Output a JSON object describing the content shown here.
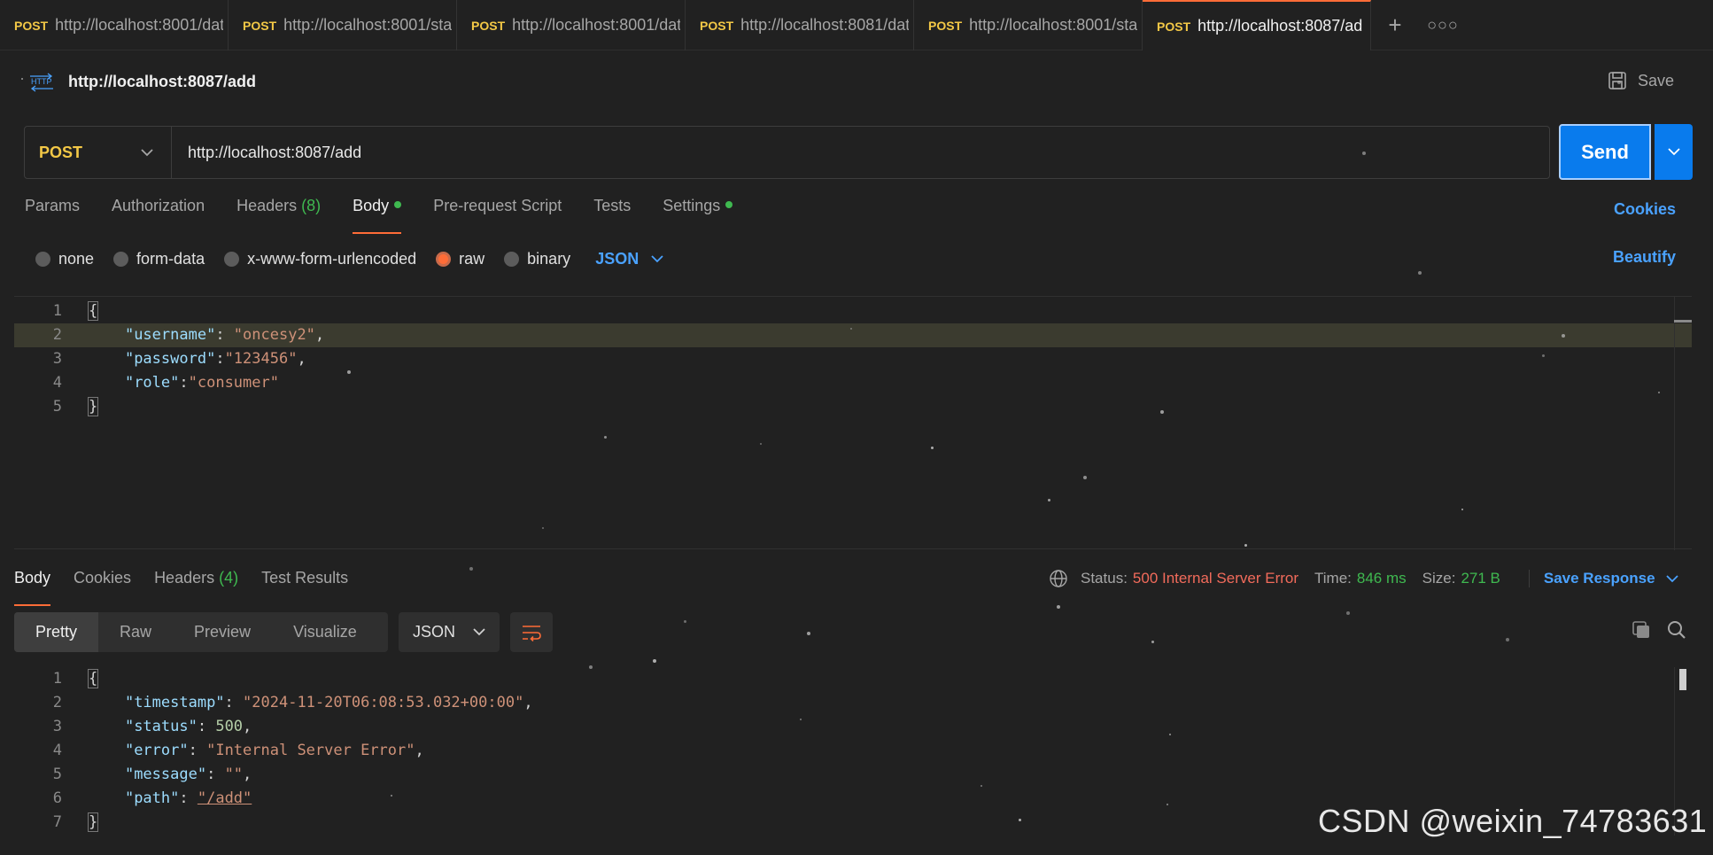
{
  "tabs": [
    {
      "method": "POST",
      "url": "http://localhost:8001/dat"
    },
    {
      "method": "POST",
      "url": "http://localhost:8001/sta"
    },
    {
      "method": "POST",
      "url": "http://localhost:8001/dat"
    },
    {
      "method": "POST",
      "url": "http://localhost:8081/dat"
    },
    {
      "method": "POST",
      "url": "http://localhost:8001/sta"
    },
    {
      "method": "POST",
      "url": "http://localhost:8087/ad"
    }
  ],
  "request": {
    "title": "http://localhost:8087/add",
    "save_label": "Save",
    "method": "POST",
    "url": "http://localhost:8087/add",
    "send_label": "Send"
  },
  "request_tabs": {
    "params": "Params",
    "authorization": "Authorization",
    "headers": "Headers",
    "headers_count": "(8)",
    "body": "Body",
    "prerequest": "Pre-request Script",
    "tests": "Tests",
    "settings": "Settings",
    "cookies": "Cookies"
  },
  "body_types": {
    "none": "none",
    "form_data": "form-data",
    "urlencoded": "x-www-form-urlencoded",
    "raw": "raw",
    "binary": "binary",
    "format": "JSON",
    "beautify": "Beautify"
  },
  "request_body": {
    "line_numbers": [
      "1",
      "2",
      "3",
      "4",
      "5"
    ],
    "username_key": "\"username\"",
    "username_value": "\"oncesy2\"",
    "password_key": "\"password\"",
    "password_value": "\"123456\"",
    "role_key": "\"role\"",
    "role_value": "\"consumer\""
  },
  "response_tabs": {
    "body": "Body",
    "cookies": "Cookies",
    "headers": "Headers",
    "headers_count": "(4)",
    "test_results": "Test Results"
  },
  "status": {
    "status_label": "Status:",
    "status_value": "500 Internal Server Error",
    "time_label": "Time:",
    "time_value": "846 ms",
    "size_label": "Size:",
    "size_value": "271 B",
    "save_response": "Save Response"
  },
  "views": {
    "pretty": "Pretty",
    "raw": "Raw",
    "preview": "Preview",
    "visualize": "Visualize",
    "format": "JSON"
  },
  "response_body": {
    "line_numbers": [
      "1",
      "2",
      "3",
      "4",
      "5",
      "6",
      "7"
    ],
    "timestamp_key": "\"timestamp\"",
    "timestamp_value": "\"2024-11-20T06:08:53.032+00:00\"",
    "status_key": "\"status\"",
    "status_value": "500",
    "error_key": "\"error\"",
    "error_value": "\"Internal Server Error\"",
    "message_key": "\"message\"",
    "message_value": "\"\"",
    "path_key": "\"path\"",
    "path_value": "\"/add\""
  },
  "watermark": "CSDN @weixin_74783631",
  "colors": {
    "accent": "#ff6c37",
    "send": "#097bed",
    "link": "#4aa2ff",
    "success": "#3fb950",
    "error": "#f26b5b",
    "method": "#f3c846"
  }
}
